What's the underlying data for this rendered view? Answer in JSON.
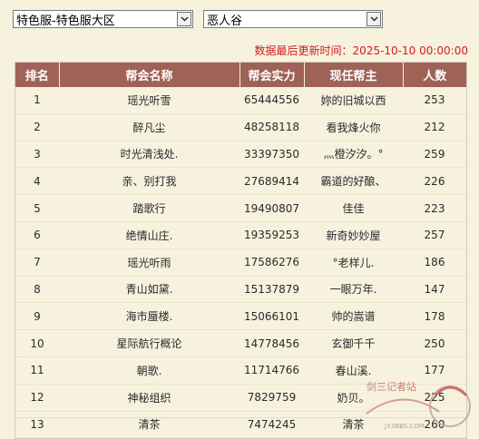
{
  "filters": {
    "server": "特色服-特色服大区",
    "region": "恶人谷"
  },
  "update_text": "数据最后更新时间：2025-10-10 00:00:00",
  "table": {
    "headers": [
      "排名",
      "帮会名称",
      "帮会实力",
      "现任帮主",
      "人数"
    ],
    "rows": [
      [
        "1",
        "瑶光听雪",
        "65444556",
        "妳的旧城以西",
        "253"
      ],
      [
        "2",
        "醉凡尘",
        "48258118",
        "看我烽火你",
        "212"
      ],
      [
        "3",
        "时光清浅处.",
        "33397350",
        "灬橙汐汐。°",
        "259"
      ],
      [
        "4",
        "亲、别打我",
        "27689414",
        "霸道的好酿、",
        "226"
      ],
      [
        "5",
        "踏歌行",
        "19490807",
        "佳佳",
        "223"
      ],
      [
        "6",
        "绝情山庄.",
        "19359253",
        "新奇妙妙屋",
        "257"
      ],
      [
        "7",
        "瑶光听雨",
        "17586276",
        "°老样儿.",
        "186"
      ],
      [
        "8",
        "青山如黛.",
        "15137879",
        "一眼万年.",
        "147"
      ],
      [
        "9",
        "海市蜃楼.",
        "15066101",
        "帅的嵩谱",
        "178"
      ],
      [
        "10",
        "星际航行概论",
        "14778456",
        "玄御千千",
        "250"
      ],
      [
        "11",
        "朝歌.",
        "11714766",
        "春山溪.",
        "177"
      ],
      [
        "12",
        "神秘组织",
        "7829759",
        "奶贝。",
        "225"
      ],
      [
        "13",
        "清茶",
        "7474245",
        "清茶",
        "260"
      ]
    ]
  },
  "watermark": {
    "line1": "剑三记者站",
    "line2": "JX3BBS.COM"
  },
  "colors": {
    "header_bg": "#9f6256",
    "page_bg": "#f7f2de",
    "update_text": "#d51a1a"
  },
  "icons": {
    "dropdown": "chevron-down-icon"
  }
}
